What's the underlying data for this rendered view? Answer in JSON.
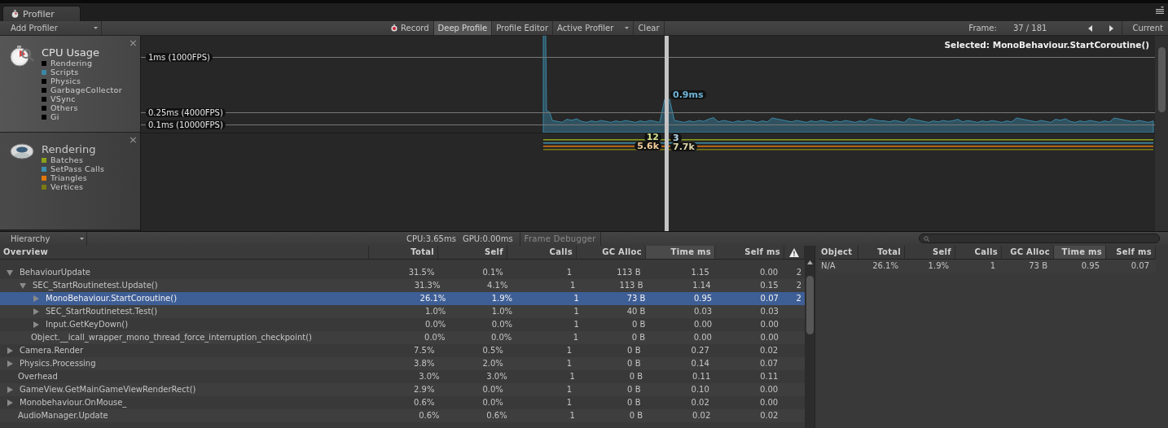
{
  "window": {
    "tab": "Profiler"
  },
  "toolbar": {
    "add_profiler": "Add Profiler",
    "buttons": [
      {
        "label": "Record",
        "kind": "record",
        "on": false
      },
      {
        "label": "Deep Profile",
        "kind": "toggle",
        "on": true
      },
      {
        "label": "Profile Editor",
        "kind": "toggle",
        "on": false
      },
      {
        "label": "Active Profiler",
        "kind": "dropdown"
      },
      {
        "label": "Clear",
        "kind": "button"
      }
    ],
    "frame_label": "Frame:",
    "frame": "37 / 181",
    "current": "Current"
  },
  "modules": [
    {
      "kind": "cpu",
      "title": "CPU Usage",
      "close": "×",
      "legend": [
        {
          "label": "Rendering",
          "color": "#000000"
        },
        {
          "label": "Scripts",
          "color": "#3b87a6"
        },
        {
          "label": "Physics",
          "color": "#000000"
        },
        {
          "label": "GarbageCollector",
          "color": "#000000"
        },
        {
          "label": "VSync",
          "color": "#000000"
        },
        {
          "label": "Others",
          "color": "#000000"
        },
        {
          "label": "Gi",
          "color": "#000000"
        }
      ],
      "guides": [
        "1ms (1000FPS)",
        "0.25ms (4000FPS)",
        "0.1ms (10000FPS)"
      ],
      "selected_label": "Selected: MonoBehaviour.StartCoroutine()",
      "value_labels": [
        {
          "text": "0.9ms",
          "color": "#6db3d6"
        }
      ]
    },
    {
      "kind": "rendering",
      "title": "Rendering",
      "close": "×",
      "legend": [
        {
          "label": "Batches",
          "color": "#8ca21a"
        },
        {
          "label": "SetPass Calls",
          "color": "#3b8fb0"
        },
        {
          "label": "Triangles",
          "color": "#e0780c"
        },
        {
          "label": "Vertices",
          "color": "#7a7a14"
        }
      ],
      "value_labels": [
        {
          "text": "12",
          "color": "#d2e08e"
        },
        {
          "text": "3",
          "color": "#b8d8ea"
        },
        {
          "text": "5.6k",
          "color": "#f2cc98"
        },
        {
          "text": "7.7k",
          "color": "#dcd4a8"
        }
      ]
    }
  ],
  "hierarchy_bar": {
    "view": "Hierarchy",
    "cpu": "CPU:3.65ms",
    "gpu": "GPU:0.00ms",
    "frame_debugger": "Frame Debugger"
  },
  "hierarchy": {
    "columns": [
      {
        "label": "Overview",
        "sorted": false
      },
      {
        "label": "Total",
        "sorted": false
      },
      {
        "label": "Self",
        "sorted": false
      },
      {
        "label": "Calls",
        "sorted": false
      },
      {
        "label": "GC Alloc",
        "sorted": false
      },
      {
        "label": "Time ms",
        "sorted": true
      },
      {
        "label": "Self ms",
        "sorted": false
      }
    ],
    "rows": [
      {
        "name": "BehaviourUpdate",
        "kind": "group",
        "expanded": true,
        "selected": false,
        "total": "31.5%",
        "self": "0.1%",
        "calls": "1",
        "gc_alloc": "113 B",
        "time_ms": "1.15",
        "self_ms": "0.00",
        "warnings": "2",
        "children": [
          {
            "name": "SEC_StartRoutinetest.Update()",
            "kind": "group",
            "expanded": true,
            "selected": false,
            "total": "31.3%",
            "self": "4.1%",
            "calls": "1",
            "gc_alloc": "113 B",
            "time_ms": "1.14",
            "self_ms": "0.15",
            "warnings": "2",
            "children": [
              {
                "name": "MonoBehaviour.StartCoroutine()",
                "kind": "group",
                "expanded": false,
                "selected": true,
                "total": "26.1%",
                "self": "1.9%",
                "calls": "1",
                "gc_alloc": "73 B",
                "time_ms": "0.95",
                "self_ms": "0.07",
                "warnings": "2"
              },
              {
                "name": "SEC_StartRoutinetest.Test()",
                "kind": "group",
                "expanded": false,
                "selected": false,
                "total": "1.0%",
                "self": "1.0%",
                "calls": "1",
                "gc_alloc": "40 B",
                "time_ms": "0.03",
                "self_ms": "0.03"
              },
              {
                "name": "Input.GetKeyDown()",
                "kind": "group",
                "expanded": false,
                "selected": false,
                "total": "0.0%",
                "self": "0.0%",
                "calls": "1",
                "gc_alloc": "0 B",
                "time_ms": "0.00",
                "self_ms": "0.00"
              }
            ]
          },
          {
            "name": "Object.__icall_wrapper_mono_thread_force_interruption_checkpoint()",
            "kind": "leaf",
            "selected": false,
            "total": "0.0%",
            "self": "0.0%",
            "calls": "1",
            "gc_alloc": "0 B",
            "time_ms": "0.00",
            "self_ms": "0.00"
          }
        ]
      },
      {
        "name": "Camera.Render",
        "kind": "group",
        "expanded": false,
        "selected": false,
        "total": "7.5%",
        "self": "0.5%",
        "calls": "1",
        "gc_alloc": "0 B",
        "time_ms": "0.27",
        "self_ms": "0.02"
      },
      {
        "name": "Physics.Processing",
        "kind": "group",
        "expanded": false,
        "selected": false,
        "total": "3.8%",
        "self": "2.0%",
        "calls": "1",
        "gc_alloc": "0 B",
        "time_ms": "0.14",
        "self_ms": "0.07"
      },
      {
        "name": "Overhead",
        "kind": "leaf",
        "selected": false,
        "total": "3.0%",
        "self": "3.0%",
        "calls": "1",
        "gc_alloc": "0 B",
        "time_ms": "0.11",
        "self_ms": "0.11"
      },
      {
        "name": "GameView.GetMainGameViewRenderRect()",
        "kind": "group",
        "expanded": false,
        "selected": false,
        "total": "2.9%",
        "self": "0.0%",
        "calls": "1",
        "gc_alloc": "0 B",
        "time_ms": "0.10",
        "self_ms": "0.00"
      },
      {
        "name": "Monobehaviour.OnMouse_",
        "kind": "group",
        "expanded": false,
        "selected": false,
        "total": "0.6%",
        "self": "0.0%",
        "calls": "1",
        "gc_alloc": "0 B",
        "time_ms": "0.02",
        "self_ms": "0.00"
      },
      {
        "name": "AudioManager.Update",
        "kind": "leaf",
        "selected": false,
        "total": "0.6%",
        "self": "0.6%",
        "calls": "1",
        "gc_alloc": "0 B",
        "time_ms": "0.02",
        "self_ms": "0.02"
      }
    ]
  },
  "detail": {
    "columns": [
      {
        "label": "Object",
        "sorted": false
      },
      {
        "label": "Total",
        "sorted": false
      },
      {
        "label": "Self",
        "sorted": false
      },
      {
        "label": "Calls",
        "sorted": false
      },
      {
        "label": "GC Alloc",
        "sorted": false
      },
      {
        "label": "Time ms",
        "sorted": true
      },
      {
        "label": "Self ms",
        "sorted": false
      }
    ],
    "rows": [
      {
        "object": "N/A",
        "total": "26.1%",
        "self": "1.9%",
        "calls": "1",
        "gc_alloc": "73 B",
        "time_ms": "0.95",
        "self_ms": "0.07"
      }
    ]
  }
}
